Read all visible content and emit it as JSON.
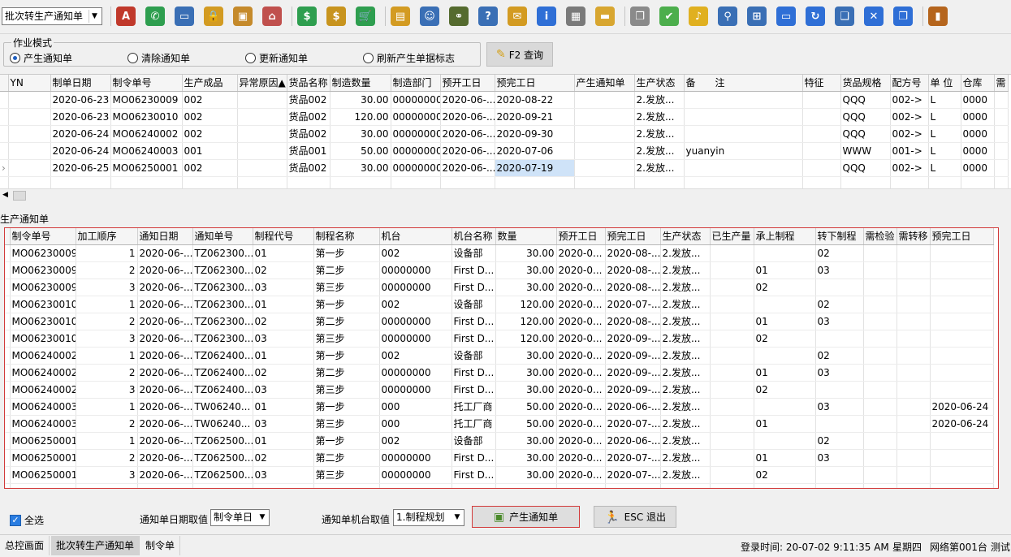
{
  "toolbar": {
    "mode_select": "批次转生产通知单",
    "icons": [
      {
        "name": "spellcheck-icon",
        "glyph": "A",
        "color": "#c0392b"
      },
      {
        "name": "phone-icon",
        "glyph": "✆",
        "color": "#2e9e4f"
      },
      {
        "name": "computer-icon",
        "glyph": "▭",
        "color": "#3a6fb5"
      },
      {
        "name": "lock-icon",
        "glyph": "🔒",
        "color": "#d39b22"
      },
      {
        "name": "briefcase-icon",
        "glyph": "▣",
        "color": "#c58a2b"
      },
      {
        "name": "home-icon",
        "glyph": "⌂",
        "color": "#c0504d"
      },
      {
        "name": "dollar-icon",
        "glyph": "$",
        "color": "#2e9e4f"
      },
      {
        "name": "moneybag-icon",
        "glyph": "$",
        "color": "#c8941e"
      },
      {
        "name": "cart-icon",
        "glyph": "🛒",
        "color": "#2e9e4f"
      },
      {
        "name": "clipboard-icon",
        "glyph": "▤",
        "color": "#d39b22"
      },
      {
        "name": "users-icon",
        "glyph": "☺",
        "color": "#3a6fb5"
      },
      {
        "name": "link-icon",
        "glyph": "⚭",
        "color": "#556b2f"
      },
      {
        "name": "help-document-icon",
        "glyph": "?",
        "color": "#3a6fb5"
      },
      {
        "name": "mail-icon",
        "glyph": "✉",
        "color": "#d39b22"
      },
      {
        "name": "info-icon",
        "glyph": "i",
        "color": "#2f6fd6"
      },
      {
        "name": "calculator-icon",
        "glyph": "▦",
        "color": "#7a7a7a"
      },
      {
        "name": "folder-icon",
        "glyph": "▬",
        "color": "#d8a630"
      },
      {
        "name": "copy-icon",
        "glyph": "❐",
        "color": "#8a8a8a"
      },
      {
        "name": "check-icon",
        "glyph": "✔",
        "color": "#4cae4c"
      },
      {
        "name": "bell-icon",
        "glyph": "♪",
        "color": "#e0b020"
      },
      {
        "name": "search-icon",
        "glyph": "⚲",
        "color": "#3a6fb5"
      },
      {
        "name": "org-chart-icon",
        "glyph": "⊞",
        "color": "#3a6fb5"
      },
      {
        "name": "monitor-icon",
        "glyph": "▭",
        "color": "#2f6fd6"
      },
      {
        "name": "refresh-icon",
        "glyph": "↻",
        "color": "#2f6fd6"
      },
      {
        "name": "windows-icon",
        "glyph": "❏",
        "color": "#3a6fb5"
      },
      {
        "name": "close-window-icon",
        "glyph": "✕",
        "color": "#2f6fd6"
      },
      {
        "name": "restore-icon",
        "glyph": "❐",
        "color": "#2f6fd6"
      },
      {
        "name": "exit-door-icon",
        "glyph": "▮",
        "color": "#b5651d"
      }
    ]
  },
  "mode_panel": {
    "legend": "作业模式",
    "options": [
      "产生通知单",
      "清除通知单",
      "更新通知单",
      "刷新产生单据标志"
    ],
    "selected": 0,
    "query_button": "F2 查询"
  },
  "grid1": {
    "columns": [
      "YN",
      "制单日期",
      "制令单号",
      "生产成品",
      "异常原因▲",
      "货品名称",
      "制造数量",
      "制造部门",
      "预开工日",
      "预完工日",
      "产生通知单",
      "生产状态",
      "备　　注",
      "特征",
      "货品规格",
      "配方号",
      "单 位",
      "仓库",
      "需"
    ],
    "rows": [
      [
        "",
        "2020-06-23",
        "MO06230009",
        "002",
        "",
        "货品002",
        "30.00",
        "00000000",
        "2020-06-...",
        "2020-08-22",
        "",
        "2.发放...",
        "",
        "",
        "QQQ",
        "002->",
        "L",
        "0000",
        ""
      ],
      [
        "",
        "2020-06-23",
        "MO06230010",
        "002",
        "",
        "货品002",
        "120.00",
        "00000000",
        "2020-06-...",
        "2020-09-21",
        "",
        "2.发放...",
        "",
        "",
        "QQQ",
        "002->",
        "L",
        "0000",
        ""
      ],
      [
        "",
        "2020-06-24",
        "MO06240002",
        "002",
        "",
        "货品002",
        "30.00",
        "00000000",
        "2020-06-...",
        "2020-09-30",
        "",
        "2.发放...",
        "",
        "",
        "QQQ",
        "002->",
        "L",
        "0000",
        ""
      ],
      [
        "",
        "2020-06-24",
        "MO06240003",
        "001",
        "",
        "货品001",
        "50.00",
        "00000000",
        "2020-06-...",
        "2020-07-06",
        "",
        "2.发放...",
        "yuanyin",
        "",
        "WWW",
        "001->",
        "L",
        "0000",
        ""
      ],
      [
        "",
        "2020-06-25",
        "MO06250001",
        "002",
        "",
        "货品002",
        "30.00",
        "00000000",
        "2020-06-...",
        "2020-07-19",
        "",
        "2.发放...",
        "",
        "",
        "QQQ",
        "002->",
        "L",
        "0000",
        ""
      ]
    ]
  },
  "section_label": "生产通知单",
  "grid2": {
    "columns": [
      "制令单号",
      "加工顺序",
      "通知日期",
      "通知单号",
      "制程代号",
      "制程名称",
      "机台",
      "机台名称",
      "数量",
      "预开工日",
      "预完工日",
      "生产状态",
      "已生产量",
      "承上制程",
      "转下制程",
      "需检验",
      "需转移",
      "预完工日"
    ],
    "rows": [
      [
        "MO06230009",
        "1",
        "2020-06-...",
        "TZ062300...",
        "01",
        "第一步",
        "002",
        "设备部",
        "30.00",
        "2020-0...",
        "2020-08-...",
        "2.发放...",
        "",
        "",
        "02",
        "",
        "",
        ""
      ],
      [
        "MO06230009",
        "2",
        "2020-06-...",
        "TZ062300...",
        "02",
        "第二步",
        "00000000",
        "First D...",
        "30.00",
        "2020-0...",
        "2020-08-...",
        "2.发放...",
        "",
        "01",
        "03",
        "",
        "",
        ""
      ],
      [
        "MO06230009",
        "3",
        "2020-06-...",
        "TZ062300...",
        "03",
        "第三步",
        "00000000",
        "First D...",
        "30.00",
        "2020-0...",
        "2020-08-...",
        "2.发放...",
        "",
        "02",
        "",
        "",
        "",
        ""
      ],
      [
        "MO06230010",
        "1",
        "2020-06-...",
        "TZ062300...",
        "01",
        "第一步",
        "002",
        "设备部",
        "120.00",
        "2020-0...",
        "2020-07-...",
        "2.发放...",
        "",
        "",
        "02",
        "",
        "",
        ""
      ],
      [
        "MO06230010",
        "2",
        "2020-06-...",
        "TZ062300...",
        "02",
        "第二步",
        "00000000",
        "First D...",
        "120.00",
        "2020-0...",
        "2020-08-...",
        "2.发放...",
        "",
        "01",
        "03",
        "",
        "",
        ""
      ],
      [
        "MO06230010",
        "3",
        "2020-06-...",
        "TZ062300...",
        "03",
        "第三步",
        "00000000",
        "First D...",
        "120.00",
        "2020-0...",
        "2020-09-...",
        "2.发放...",
        "",
        "02",
        "",
        "",
        "",
        ""
      ],
      [
        "MO06240002",
        "1",
        "2020-06-...",
        "TZ062400...",
        "01",
        "第一步",
        "002",
        "设备部",
        "30.00",
        "2020-0...",
        "2020-09-...",
        "2.发放...",
        "",
        "",
        "02",
        "",
        "",
        ""
      ],
      [
        "MO06240002",
        "2",
        "2020-06-...",
        "TZ062400...",
        "02",
        "第二步",
        "00000000",
        "First D...",
        "30.00",
        "2020-0...",
        "2020-09-...",
        "2.发放...",
        "",
        "01",
        "03",
        "",
        "",
        ""
      ],
      [
        "MO06240002",
        "3",
        "2020-06-...",
        "TZ062400...",
        "03",
        "第三步",
        "00000000",
        "First D...",
        "30.00",
        "2020-0...",
        "2020-09-...",
        "2.发放...",
        "",
        "02",
        "",
        "",
        "",
        ""
      ],
      [
        "MO06240003",
        "1",
        "2020-06-...",
        "TW06240...",
        "01",
        "第一步",
        "000",
        "托工厂商",
        "50.00",
        "2020-0...",
        "2020-06-...",
        "2.发放...",
        "",
        "",
        "03",
        "",
        "",
        "2020-06-24"
      ],
      [
        "MO06240003",
        "2",
        "2020-06-...",
        "TW06240...",
        "03",
        "第三步",
        "000",
        "托工厂商",
        "50.00",
        "2020-0...",
        "2020-07-...",
        "2.发放...",
        "",
        "01",
        "",
        "",
        "",
        "2020-06-24"
      ],
      [
        "MO06250001",
        "1",
        "2020-06-...",
        "TZ062500...",
        "01",
        "第一步",
        "002",
        "设备部",
        "30.00",
        "2020-0...",
        "2020-06-...",
        "2.发放...",
        "",
        "",
        "02",
        "",
        "",
        ""
      ],
      [
        "MO06250001",
        "2",
        "2020-06-...",
        "TZ062500...",
        "02",
        "第二步",
        "00000000",
        "First D...",
        "30.00",
        "2020-0...",
        "2020-07-...",
        "2.发放...",
        "",
        "01",
        "03",
        "",
        "",
        ""
      ],
      [
        "MO06250001",
        "3",
        "2020-06-...",
        "TZ062500...",
        "03",
        "第三步",
        "00000000",
        "First D...",
        "30.00",
        "2020-0...",
        "2020-07-...",
        "2.发放...",
        "",
        "02",
        "",
        "",
        "",
        ""
      ]
    ]
  },
  "bottom": {
    "select_all": "全选",
    "date_label": "通知单日期取值",
    "date_value": "制令单日",
    "machine_label": "通知单机台取值",
    "machine_value": "1.制程规划",
    "generate_button": "产生通知单",
    "exit_button": "ESC 退出"
  },
  "status": {
    "tabs": [
      "总控画面",
      "批次转生产通知单",
      "制令单"
    ],
    "active_tab": 1,
    "login": "登录时间: 20-07-02 9:11:35 AM",
    "weekday": "星期四",
    "network": "网络第001台",
    "extra": "测试"
  }
}
